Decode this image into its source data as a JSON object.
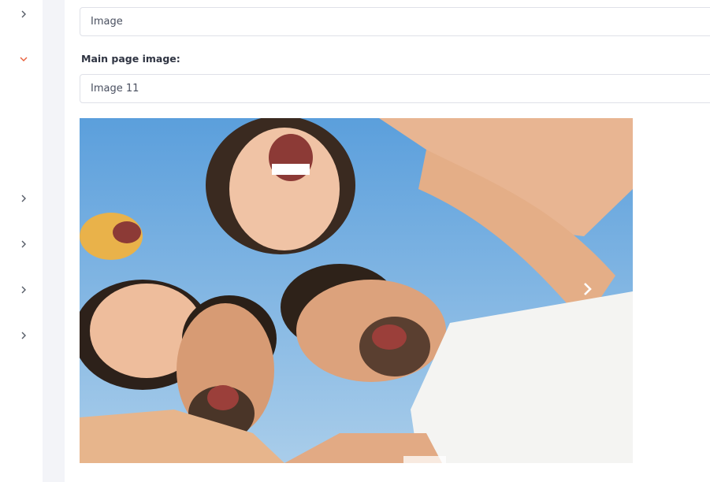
{
  "sidebar": {
    "items": [
      {
        "icon": "chevron-right-icon"
      },
      {
        "icon": "chevron-down-icon",
        "active_color": "#e8603c"
      },
      {
        "icon": "chevron-right-icon"
      },
      {
        "icon": "chevron-right-icon"
      },
      {
        "icon": "chevron-right-icon"
      },
      {
        "icon": "chevron-right-icon"
      }
    ]
  },
  "form": {
    "type_select": {
      "value": "Image"
    },
    "main_image_label": "Main page image:",
    "main_image_select": {
      "value": "Image 11"
    }
  },
  "preview": {
    "icon": "chevron-right-icon"
  },
  "colors": {
    "accent": "#e8603c",
    "border": "#dfe1e8",
    "sky": "#6aa8de"
  }
}
